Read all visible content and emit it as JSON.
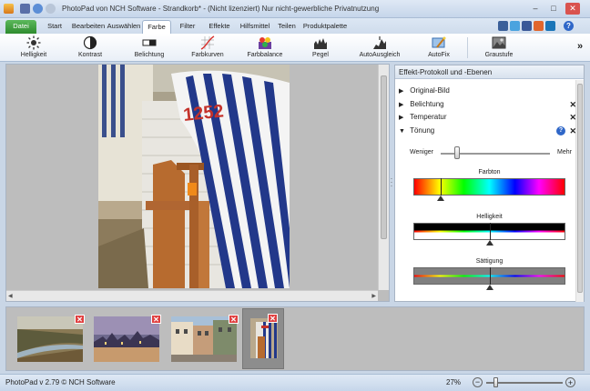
{
  "window": {
    "title": "PhotoPad von NCH Software - Strandkorb* - (Nicht lizenziert) Nur nicht-gewerbliche Privatnutzung",
    "minimize": "–",
    "maximize": "□",
    "close": "✕"
  },
  "tabs": [
    {
      "label": "Datei"
    },
    {
      "label": "Start"
    },
    {
      "label": "Bearbeiten"
    },
    {
      "label": "Auswählen"
    },
    {
      "label": "Farbe"
    },
    {
      "label": "Filter"
    },
    {
      "label": "Effekte"
    },
    {
      "label": "Hilfsmittel"
    },
    {
      "label": "Teilen"
    },
    {
      "label": "Produktpalette"
    }
  ],
  "active_tab": "Farbe",
  "help_glyph": "?",
  "ribbon": {
    "items": [
      {
        "label": "Helligkeit",
        "icon": "brightness-icon"
      },
      {
        "label": "Kontrast",
        "icon": "contrast-icon"
      },
      {
        "label": "Belichtung",
        "icon": "exposure-icon"
      },
      {
        "label": "Farbkurven",
        "icon": "color-curves-icon"
      },
      {
        "label": "Farbbalance",
        "icon": "color-balance-icon"
      },
      {
        "label": "Pegel",
        "icon": "levels-icon"
      },
      {
        "label": "AutoAusgleich",
        "icon": "auto-level-icon"
      },
      {
        "label": "AutoFix",
        "icon": "autofix-icon"
      },
      {
        "label": "Graustufe",
        "icon": "grayscale-icon"
      }
    ],
    "more": "»"
  },
  "photo": {
    "number_text": "1252"
  },
  "effects_panel": {
    "header": "Effekt-Protokoll und -Ebenen",
    "items": [
      {
        "label": "Original-Bild",
        "expanded": false,
        "removable": false
      },
      {
        "label": "Belichtung",
        "expanded": false,
        "removable": true
      },
      {
        "label": "Temperatur",
        "expanded": false,
        "removable": true
      },
      {
        "label": "Tönung",
        "expanded": true,
        "removable": true
      }
    ],
    "collapsed_arrow": "▶",
    "expanded_arrow": "▼",
    "remove_glyph": "✕",
    "help_glyph": "?",
    "slider": {
      "less": "Weniger",
      "more": "Mehr",
      "value": 0.15
    },
    "farbton_label": "Farbton",
    "farbton_value": 0.18,
    "helligkeit_label": "Helligkeit",
    "helligkeit_value": 0.5,
    "saettigung_label": "Sättigung",
    "saettigung_value": 0.5
  },
  "filmstrip": {
    "thumbs": [
      {
        "name": "thumb-river-valley"
      },
      {
        "name": "thumb-city-night"
      },
      {
        "name": "thumb-old-town-street"
      },
      {
        "name": "thumb-beach-chair",
        "selected": true
      }
    ],
    "delete_glyph": "✕"
  },
  "status": {
    "app_version": "PhotoPad v 2.79 © NCH Software",
    "zoom": "27%",
    "zoom_out": "−",
    "zoom_in": "+",
    "zoom_slider_value": 0.12
  },
  "colors": {
    "file_tab": "#3a9a3a",
    "help": "#2f67c8",
    "delete": "#e04040"
  }
}
